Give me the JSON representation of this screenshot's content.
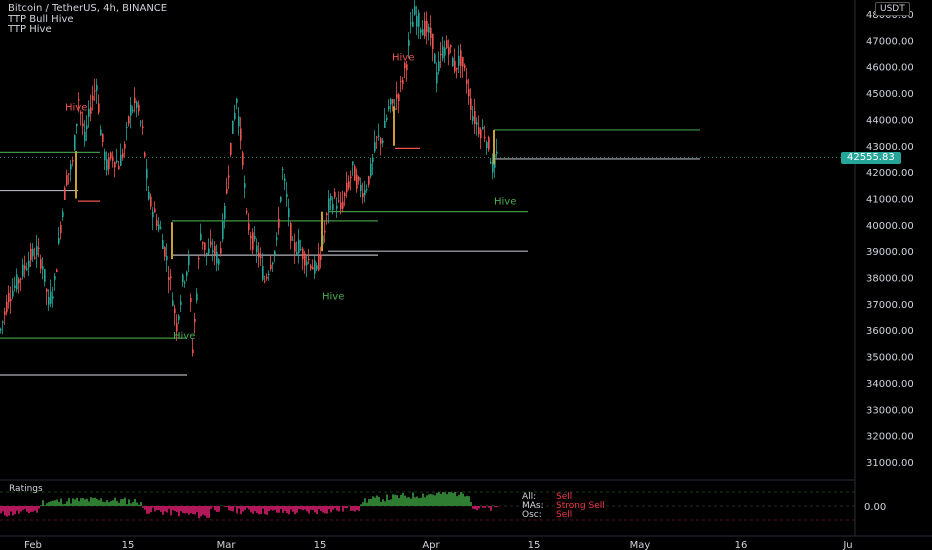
{
  "symbol": {
    "title": "Bitcoin / TetherUS, 4h, BINANCE",
    "indicators": [
      "TTP Bull Hive",
      "TTP Hive"
    ]
  },
  "price_axis": {
    "currency": "USDT",
    "current_price": "42555.83",
    "ticks": [
      "48000.00",
      "47000.00",
      "46000.00",
      "45000.00",
      "44000.00",
      "43000.00",
      "42000.00",
      "41000.00",
      "40000.00",
      "39000.00",
      "38000.00",
      "37000.00",
      "36000.00",
      "35000.00",
      "34000.00",
      "33000.00",
      "32000.00",
      "31000.00"
    ]
  },
  "time_axis": {
    "ticks": [
      "Feb",
      "15",
      "Mar",
      "15",
      "Apr",
      "15",
      "May",
      "16",
      "Ju"
    ]
  },
  "hive_labels": [
    "Hive",
    "Hive",
    "Hive",
    "Hive",
    "Hive"
  ],
  "ratings": {
    "label": "Ratings",
    "zero_tick": "0.00",
    "rows": [
      {
        "key": "All:",
        "value": "Sell"
      },
      {
        "key": "MAs:",
        "value": "Strong Sell"
      },
      {
        "key": "Osc:",
        "value": "Sell"
      }
    ]
  },
  "colors": {
    "up": "#26a69a",
    "down": "#ef5350",
    "level_green": "#4caf50",
    "level_gray": "#d1d4dc",
    "rating_buy": "#2e7d32",
    "rating_sell": "#b0185a",
    "rating_text": "#f23645"
  },
  "chart_data": {
    "type": "candlestick",
    "ylim": [
      30400,
      48400
    ],
    "path_points": [
      [
        0,
        36000
      ],
      [
        8,
        37300
      ],
      [
        18,
        37900
      ],
      [
        28,
        38700
      ],
      [
        36,
        39000
      ],
      [
        42,
        38500
      ],
      [
        48,
        37000
      ],
      [
        54,
        37800
      ],
      [
        60,
        40000
      ],
      [
        66,
        41800
      ],
      [
        72,
        42300
      ],
      [
        78,
        44800
      ],
      [
        84,
        43200
      ],
      [
        90,
        44500
      ],
      [
        96,
        45400
      ],
      [
        100,
        43600
      ],
      [
        106,
        42200
      ],
      [
        112,
        42600
      ],
      [
        118,
        42300
      ],
      [
        124,
        42900
      ],
      [
        130,
        44400
      ],
      [
        136,
        44600
      ],
      [
        142,
        43500
      ],
      [
        148,
        41000
      ],
      [
        154,
        40400
      ],
      [
        160,
        39800
      ],
      [
        166,
        38700
      ],
      [
        170,
        37800
      ],
      [
        176,
        36200
      ],
      [
        182,
        37800
      ],
      [
        188,
        38600
      ],
      [
        192,
        35300
      ],
      [
        196,
        37400
      ],
      [
        200,
        39700
      ],
      [
        206,
        38900
      ],
      [
        212,
        39100
      ],
      [
        218,
        38600
      ],
      [
        224,
        40400
      ],
      [
        230,
        43000
      ],
      [
        236,
        44800
      ],
      [
        242,
        42600
      ],
      [
        246,
        40200
      ],
      [
        252,
        39400
      ],
      [
        258,
        38900
      ],
      [
        264,
        37900
      ],
      [
        270,
        38600
      ],
      [
        276,
        39200
      ],
      [
        282,
        42000
      ],
      [
        286,
        41000
      ],
      [
        292,
        39100
      ],
      [
        298,
        39200
      ],
      [
        304,
        38800
      ],
      [
        310,
        38600
      ],
      [
        316,
        38200
      ],
      [
        322,
        39300
      ],
      [
        328,
        40700
      ],
      [
        334,
        41000
      ],
      [
        340,
        40600
      ],
      [
        346,
        41300
      ],
      [
        352,
        42100
      ],
      [
        358,
        41500
      ],
      [
        364,
        41300
      ],
      [
        370,
        42000
      ],
      [
        376,
        43200
      ],
      [
        382,
        43300
      ],
      [
        388,
        44400
      ],
      [
        394,
        44600
      ],
      [
        400,
        45200
      ],
      [
        406,
        46200
      ],
      [
        410,
        47400
      ],
      [
        414,
        48000
      ],
      [
        420,
        47600
      ],
      [
        426,
        47400
      ],
      [
        432,
        47000
      ],
      [
        436,
        45600
      ],
      [
        442,
        46600
      ],
      [
        448,
        46800
      ],
      [
        454,
        46000
      ],
      [
        460,
        46300
      ],
      [
        466,
        45500
      ],
      [
        472,
        44200
      ],
      [
        478,
        43700
      ],
      [
        484,
        43500
      ],
      [
        488,
        43000
      ],
      [
        492,
        42200
      ],
      [
        496,
        42550
      ]
    ],
    "levels": [
      {
        "color": "green",
        "from": 0,
        "to": 100,
        "price": 42750
      },
      {
        "color": "gray",
        "from": 0,
        "to": 78,
        "price": 41300
      },
      {
        "color": "green",
        "from": 0,
        "to": 185,
        "price": 35700
      },
      {
        "color": "gray",
        "from": 0,
        "to": 187,
        "price": 34300
      },
      {
        "color": "green",
        "from": 172,
        "to": 378,
        "price": 40150
      },
      {
        "color": "gray",
        "from": 172,
        "to": 378,
        "price": 38850
      },
      {
        "color": "green",
        "from": 328,
        "to": 528,
        "price": 40500
      },
      {
        "color": "gray",
        "from": 328,
        "to": 528,
        "price": 39000
      },
      {
        "color": "green",
        "from": 494,
        "to": 700,
        "price": 43600
      },
      {
        "color": "gray",
        "from": 494,
        "to": 700,
        "price": 42500
      }
    ],
    "hive_markers": [
      {
        "x": 65,
        "price": 43500,
        "color": "red"
      },
      {
        "x": 173,
        "price": 36200,
        "color": "green"
      },
      {
        "x": 322,
        "price": 37700,
        "color": "green"
      },
      {
        "x": 392,
        "price": 45400,
        "color": "red"
      },
      {
        "x": 494,
        "price": 41300,
        "color": "green"
      }
    ]
  }
}
